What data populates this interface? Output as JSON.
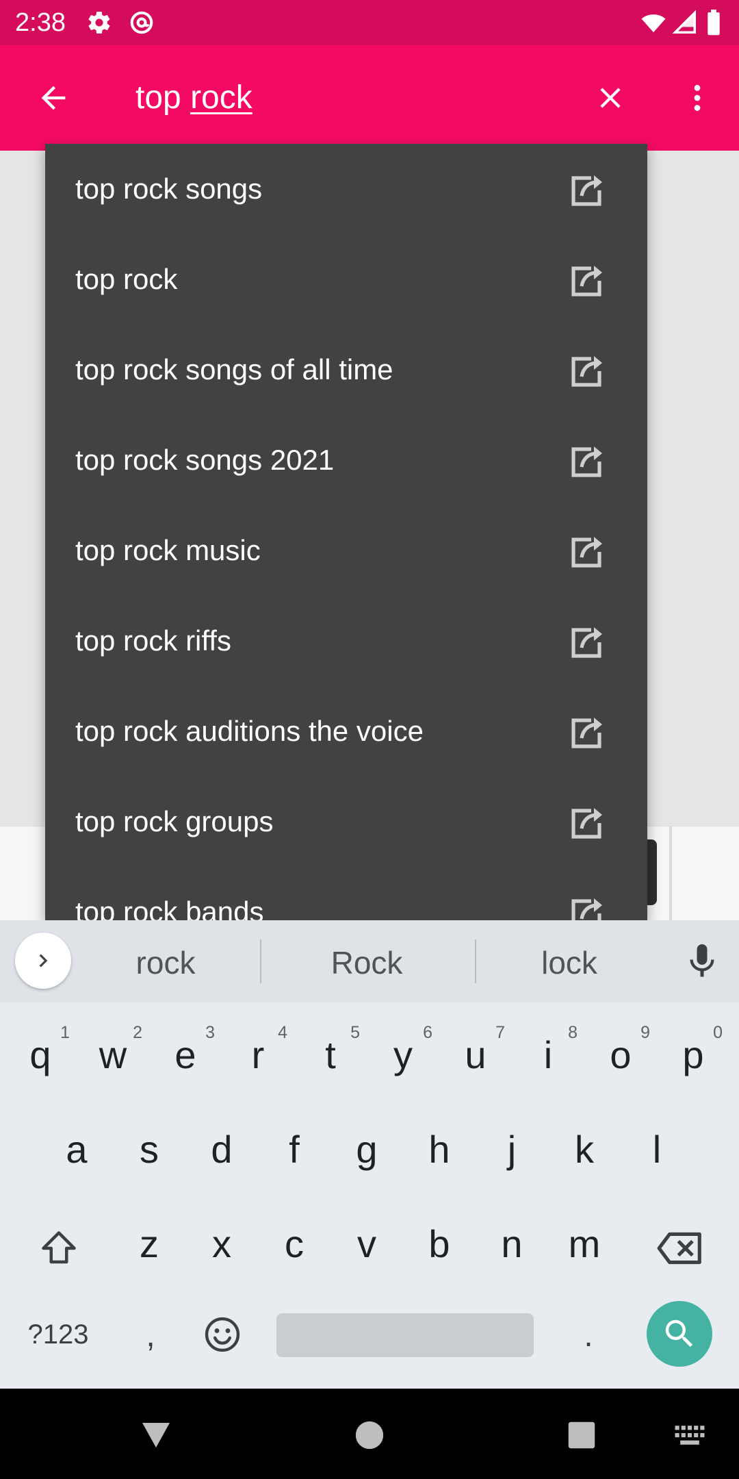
{
  "status_bar": {
    "time": "2:38"
  },
  "search": {
    "text_prefix": "top ",
    "text_composing": "rock"
  },
  "suggestions": [
    "top rock songs",
    "top rock",
    "top rock songs of all time",
    "top rock songs 2021",
    "top rock music",
    "top rock riffs",
    "top rock auditions the voice",
    "top rock groups",
    "top rock bands"
  ],
  "keyboard": {
    "word_suggestions": [
      "rock",
      "Rock",
      "lock"
    ],
    "row1": [
      {
        "ch": "q",
        "hint": "1"
      },
      {
        "ch": "w",
        "hint": "2"
      },
      {
        "ch": "e",
        "hint": "3"
      },
      {
        "ch": "r",
        "hint": "4"
      },
      {
        "ch": "t",
        "hint": "5"
      },
      {
        "ch": "y",
        "hint": "6"
      },
      {
        "ch": "u",
        "hint": "7"
      },
      {
        "ch": "i",
        "hint": "8"
      },
      {
        "ch": "o",
        "hint": "9"
      },
      {
        "ch": "p",
        "hint": "0"
      }
    ],
    "row2": [
      "a",
      "s",
      "d",
      "f",
      "g",
      "h",
      "j",
      "k",
      "l"
    ],
    "row3": [
      "z",
      "x",
      "c",
      "v",
      "b",
      "n",
      "m"
    ],
    "symbols_label": "?123",
    "comma": ",",
    "period": "."
  },
  "colors": {
    "status_bar": "#d50b5c",
    "toolbar": "#f50a63",
    "dropdown": "#424242",
    "search_key": "#45b3a4"
  },
  "icons": {
    "status": [
      "gear-icon",
      "at-sign-icon",
      "wifi-icon",
      "signal-icon",
      "battery-icon"
    ],
    "toolbar": [
      "back-arrow-icon",
      "close-icon",
      "more-vert-icon"
    ],
    "suggestion": "query-fill-arrow-icon",
    "nav": [
      "back-triangle-icon",
      "home-circle-icon",
      "recents-square-icon",
      "keyboard-icon"
    ]
  }
}
